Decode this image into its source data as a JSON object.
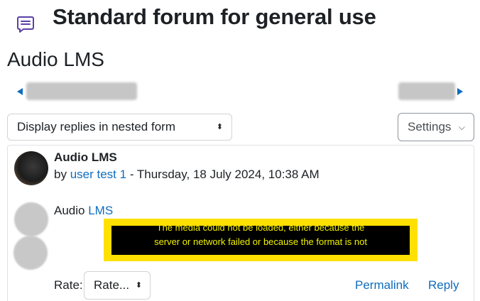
{
  "header": {
    "forum_icon": "forum-icon",
    "title": "Standard forum for general use"
  },
  "discussion": {
    "title": "Audio LMS"
  },
  "navigation": {
    "prev_icon": "triangle-left-icon",
    "next_icon": "triangle-right-icon"
  },
  "controls": {
    "display_mode": "Display replies in nested form",
    "display_caret": "⬍",
    "settings_label": "Settings",
    "settings_chevron": "⌵"
  },
  "post": {
    "subject": "Audio LMS",
    "by_prefix": "by",
    "author": "user test 1",
    "date_text": "- Thursday, 18 July 2024, 10:38 AM",
    "content_prefix": "Audio",
    "content_link": "LMS",
    "media_error_line1": "The media could not be loaded, either because the",
    "media_error_line2": "server or network failed or because the format is not",
    "rate_label": "Rate:",
    "rate_select": "Rate...",
    "rate_caret": "⬍",
    "permalink": "Permalink",
    "reply": "Reply"
  },
  "colors": {
    "link": "#0f6cbf",
    "text": "#1d2125",
    "forum_icon": "#5b3fa6",
    "media_error_frame": "#ffe000",
    "media_error_bg": "#000000"
  }
}
